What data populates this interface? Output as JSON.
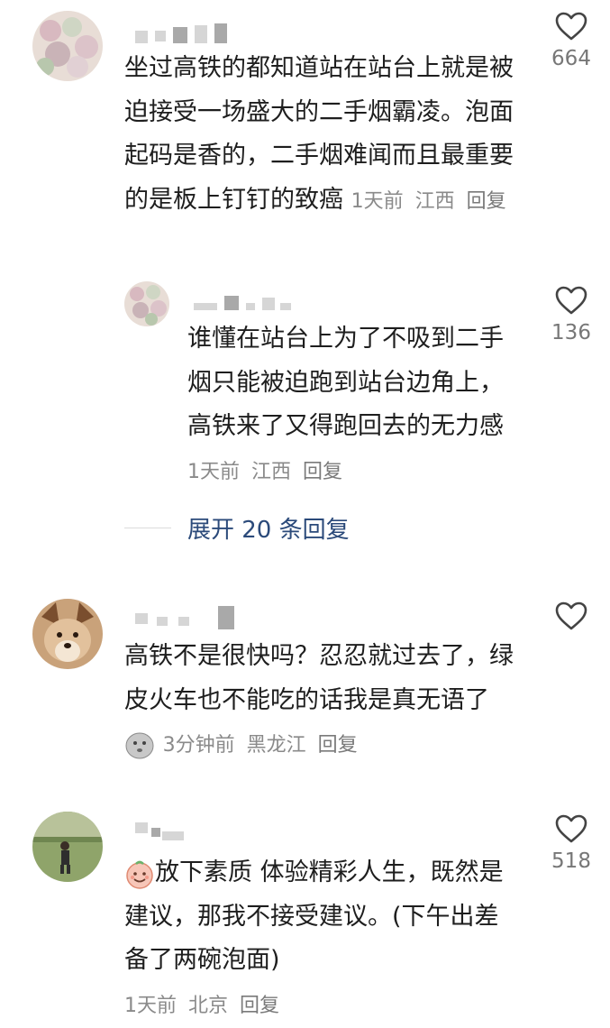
{
  "comments": [
    {
      "text": "坐过高铁的都知道站在站台上就是被迫接受一场盛大的二手烟霸凌。泡面起码是香的，二手烟难闻而且最重要的是板上钉钉的致癌",
      "time": "1天前",
      "location": "江西",
      "reply_label": "回复",
      "likes": "664",
      "avatar_icon": "flower-avatar"
    },
    {
      "text": "谁懂在站台上为了不吸到二手烟只能被迫跑到站台边角上，高铁来了又得跑回去的无力感",
      "time": "1天前",
      "location": "江西",
      "reply_label": "回复",
      "likes": "136",
      "avatar_icon": "flower-avatar"
    },
    {
      "text": "高铁不是很快吗？忍忍就过去了，绿皮火车也不能吃的话我是真无语了",
      "emoji": "speechless-emoji",
      "time": "3分钟前",
      "location": "黑龙江",
      "reply_label": "回复",
      "likes": "",
      "avatar_icon": "dog-avatar"
    },
    {
      "text": "放下素质 体验精彩人生，既然是建议，那我不接受建议。(下午出差 备了两碗泡面)",
      "emoji": "smile-emoji",
      "time": "1天前",
      "location": "北京",
      "reply_label": "回复",
      "likes": "518",
      "avatar_icon": "field-avatar"
    }
  ],
  "expand_replies": {
    "label": "展开 20 条回复"
  },
  "colors": {
    "text": "#1e1e1e",
    "meta": "#8a8a8a",
    "link": "#2b4a7a",
    "icon": "#444444"
  }
}
